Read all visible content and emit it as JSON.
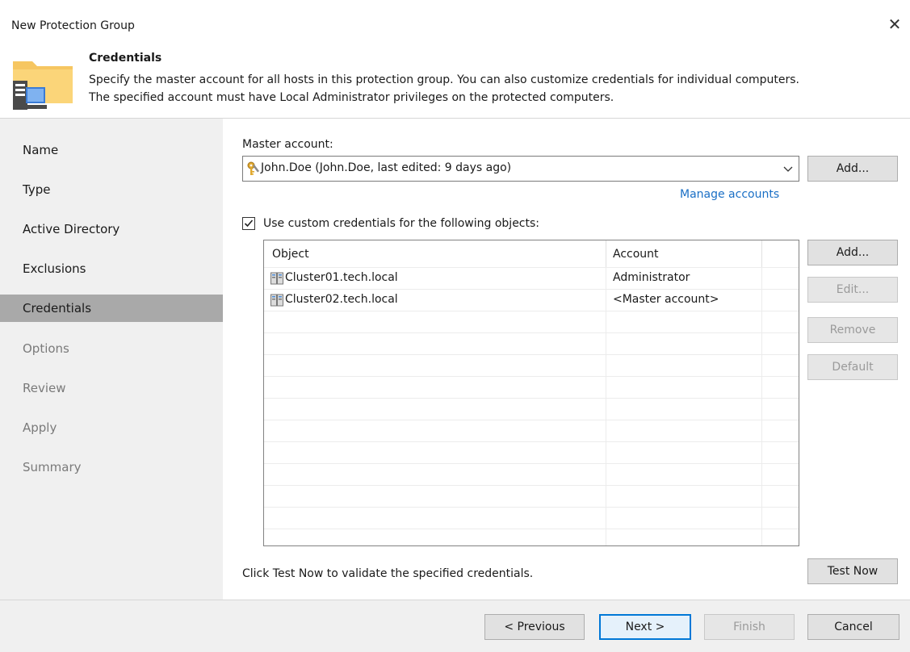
{
  "window": {
    "title": "New Protection Group",
    "close_label": "✕"
  },
  "header": {
    "title": "Credentials",
    "description_line1": "Specify the master account for all hosts in this protection group. You can also customize credentials for individual computers.",
    "description_line2": "The specified account must have Local Administrator privileges on the protected computers."
  },
  "nav": {
    "items": [
      {
        "label": "Name",
        "state": "normal"
      },
      {
        "label": "Type",
        "state": "normal"
      },
      {
        "label": "Active Directory",
        "state": "normal"
      },
      {
        "label": "Exclusions",
        "state": "normal"
      },
      {
        "label": "Credentials",
        "state": "active"
      },
      {
        "label": "Options",
        "state": "disabled"
      },
      {
        "label": "Review",
        "state": "disabled"
      },
      {
        "label": "Apply",
        "state": "disabled"
      },
      {
        "label": "Summary",
        "state": "disabled"
      }
    ]
  },
  "master": {
    "label": "Master account:",
    "selected": "John.Doe (John.Doe, last edited: 9 days ago)",
    "add_button": "Add...",
    "manage_link": "Manage accounts"
  },
  "custom": {
    "checkbox_label": "Use custom credentials for the following objects:",
    "checked": true,
    "columns": [
      "Object",
      "Account"
    ],
    "rows": [
      {
        "object": "Cluster01.tech.local",
        "account": "Administrator"
      },
      {
        "object": "Cluster02.tech.local",
        "account": "<Master account>"
      }
    ],
    "buttons": {
      "add": "Add...",
      "edit": "Edit...",
      "remove": "Remove",
      "default": "Default"
    }
  },
  "test": {
    "hint": "Click Test Now to validate the specified credentials.",
    "button": "Test Now"
  },
  "footer": {
    "previous": "< Previous",
    "next": "Next >",
    "finish": "Finish",
    "cancel": "Cancel"
  },
  "icons": {
    "header": "protection-group-folder-icon",
    "account": "key-icon",
    "object": "cluster-icon"
  },
  "colors": {
    "nav_bg": "#f0f0f0",
    "nav_active": "#a9a9a9",
    "link": "#1a6fc5",
    "primary_border": "#0078d7"
  }
}
